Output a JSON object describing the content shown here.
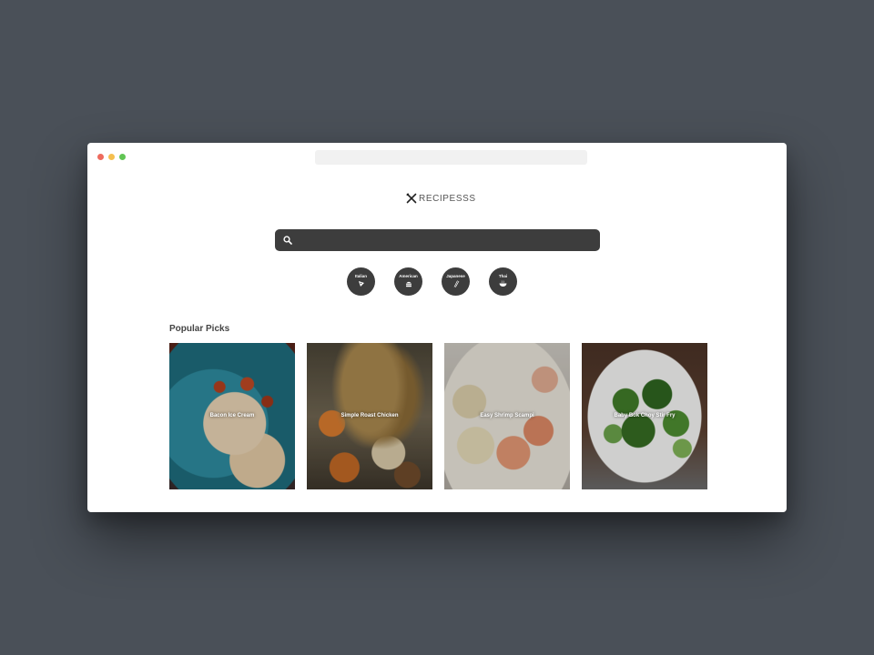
{
  "window": {
    "url": ""
  },
  "header": {
    "logo_text": "RECIPESSS"
  },
  "search": {
    "placeholder": "",
    "value": ""
  },
  "cuisines": [
    {
      "label": "Italian",
      "icon": "pizza-icon"
    },
    {
      "label": "American",
      "icon": "burger-icon"
    },
    {
      "label": "Japanese",
      "icon": "chopsticks-icon"
    },
    {
      "label": "Thai",
      "icon": "bowl-icon"
    }
  ],
  "popular": {
    "title": "Popular Picks",
    "items": [
      {
        "title": "Bacon Ice Cream"
      },
      {
        "title": "Simple Roast Chicken"
      },
      {
        "title": "Easy Shrimp Scampi"
      },
      {
        "title": "Baby Bok Choy Stir Fry"
      }
    ]
  }
}
